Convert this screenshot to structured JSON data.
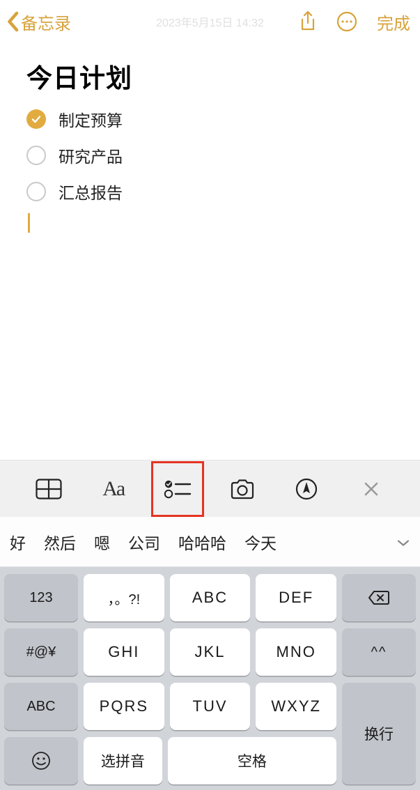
{
  "nav": {
    "back_label": "备忘录",
    "done_label": "完成"
  },
  "note": {
    "timestamp": "2023年5月15日 14:32",
    "title": "今日计划",
    "items": [
      {
        "text": "制定预算",
        "checked": true
      },
      {
        "text": "研究产品",
        "checked": false
      },
      {
        "text": "汇总报告",
        "checked": false
      }
    ]
  },
  "toolbar": {
    "aa": "Aa"
  },
  "keyboard": {
    "suggestions": [
      "好",
      "然后",
      "嗯",
      "公司",
      "哈哈哈",
      "今天"
    ],
    "keys": {
      "r1": [
        "123",
        "，。?!",
        "ABC",
        "DEF"
      ],
      "r2": [
        "#@¥",
        "GHI",
        "JKL",
        "MNO",
        "^^"
      ],
      "r3": [
        "ABC",
        "PQRS",
        "TUV",
        "WXYZ"
      ],
      "r4": {
        "pinyin": "选拼音",
        "space": "空格",
        "return": "换行"
      }
    }
  }
}
